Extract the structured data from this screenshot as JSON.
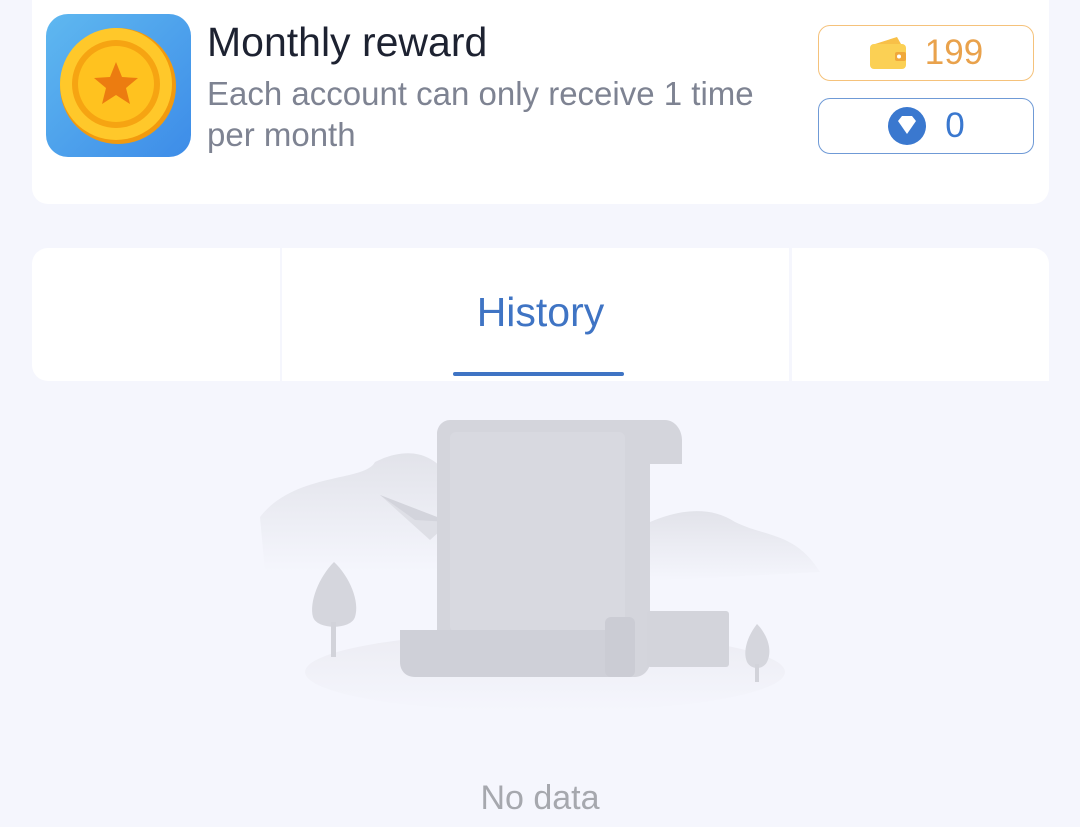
{
  "reward": {
    "title": "Monthly reward",
    "description": "Each account can only receive 1 time per month",
    "icon": "coin-star-icon",
    "coins": "199",
    "coins_icon": "wallet-icon",
    "gems": "0",
    "gems_icon": "diamond-icon"
  },
  "tabs": {
    "active_label": "History"
  },
  "empty_state": {
    "illustration": "empty-scroll-illustration",
    "text": "No data"
  },
  "colors": {
    "background": "#f5f6fd",
    "accent_blue": "#3f74c4",
    "coin_orange": "#e9a24c",
    "coin_border": "#f5c27b"
  }
}
